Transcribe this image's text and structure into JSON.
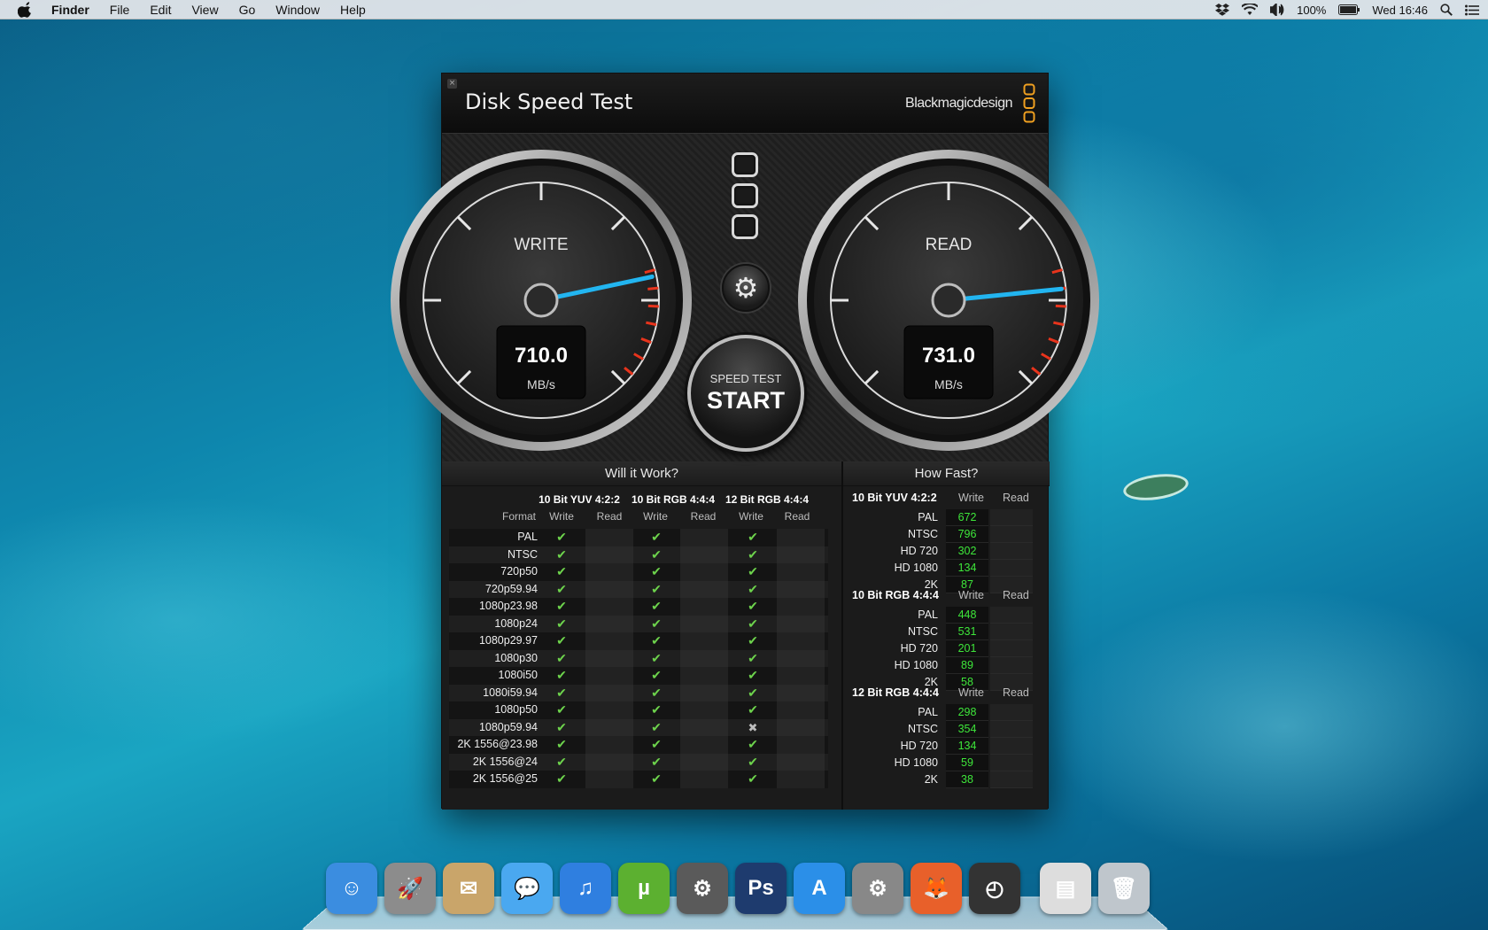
{
  "menubar": {
    "app_name": "Finder",
    "items": [
      "File",
      "Edit",
      "View",
      "Go",
      "Window",
      "Help"
    ],
    "status": {
      "battery": "100%",
      "clock": "Wed 16:46"
    }
  },
  "window": {
    "title": "Disk Speed Test",
    "brand": "Blackmagicdesign",
    "close_glyph": "×",
    "gauges": {
      "write": {
        "label": "WRITE",
        "value": "710.0",
        "unit": "MB/s",
        "needle_value": 710
      },
      "read": {
        "label": "READ",
        "value": "731.0",
        "unit": "MB/s",
        "needle_value": 731
      }
    },
    "gauge_scale_max": 900,
    "start_button": {
      "line1": "SPEED TEST",
      "line2": "START"
    },
    "gear_icon": "⚙",
    "will_it_work": {
      "title": "Will it Work?",
      "format_header": "Format",
      "groups": [
        {
          "name": "10 Bit YUV 4:2:2",
          "write": "Write",
          "read": "Read"
        },
        {
          "name": "10 Bit RGB 4:4:4",
          "write": "Write",
          "read": "Read"
        },
        {
          "name": "12 Bit RGB 4:4:4",
          "write": "Write",
          "read": "Read"
        }
      ],
      "rows": [
        {
          "format": "PAL",
          "w": [
            "✔",
            "✔",
            "✔"
          ]
        },
        {
          "format": "NTSC",
          "w": [
            "✔",
            "✔",
            "✔"
          ]
        },
        {
          "format": "720p50",
          "w": [
            "✔",
            "✔",
            "✔"
          ]
        },
        {
          "format": "720p59.94",
          "w": [
            "✔",
            "✔",
            "✔"
          ]
        },
        {
          "format": "1080p23.98",
          "w": [
            "✔",
            "✔",
            "✔"
          ]
        },
        {
          "format": "1080p24",
          "w": [
            "✔",
            "✔",
            "✔"
          ]
        },
        {
          "format": "1080p29.97",
          "w": [
            "✔",
            "✔",
            "✔"
          ]
        },
        {
          "format": "1080p30",
          "w": [
            "✔",
            "✔",
            "✔"
          ]
        },
        {
          "format": "1080i50",
          "w": [
            "✔",
            "✔",
            "✔"
          ]
        },
        {
          "format": "1080i59.94",
          "w": [
            "✔",
            "✔",
            "✔"
          ]
        },
        {
          "format": "1080p50",
          "w": [
            "✔",
            "✔",
            "✔"
          ]
        },
        {
          "format": "1080p59.94",
          "w": [
            "✔",
            "✔",
            "✖"
          ]
        },
        {
          "format": "2K 1556@23.98",
          "w": [
            "✔",
            "✔",
            "✔"
          ]
        },
        {
          "format": "2K 1556@24",
          "w": [
            "✔",
            "✔",
            "✔"
          ]
        },
        {
          "format": "2K 1556@25",
          "w": [
            "✔",
            "✔",
            "✔"
          ]
        }
      ]
    },
    "how_fast": {
      "title": "How Fast?",
      "groups": [
        {
          "name": "10 Bit YUV 4:2:2",
          "write": "Write",
          "read": "Read",
          "rows": [
            {
              "f": "PAL",
              "v": "672"
            },
            {
              "f": "NTSC",
              "v": "796"
            },
            {
              "f": "HD 720",
              "v": "302"
            },
            {
              "f": "HD 1080",
              "v": "134"
            },
            {
              "f": "2K",
              "v": "87"
            }
          ]
        },
        {
          "name": "10 Bit RGB 4:4:4",
          "write": "Write",
          "read": "Read",
          "rows": [
            {
              "f": "PAL",
              "v": "448"
            },
            {
              "f": "NTSC",
              "v": "531"
            },
            {
              "f": "HD 720",
              "v": "201"
            },
            {
              "f": "HD 1080",
              "v": "89"
            },
            {
              "f": "2K",
              "v": "58"
            }
          ]
        },
        {
          "name": "12 Bit RGB 4:4:4",
          "write": "Write",
          "read": "Read",
          "rows": [
            {
              "f": "PAL",
              "v": "298"
            },
            {
              "f": "NTSC",
              "v": "354"
            },
            {
              "f": "HD 720",
              "v": "134"
            },
            {
              "f": "HD 1080",
              "v": "59"
            },
            {
              "f": "2K",
              "v": "38"
            }
          ]
        }
      ]
    }
  },
  "dock": {
    "items": [
      {
        "name": "finder-icon",
        "glyph": "☺",
        "color": "#3b8de0"
      },
      {
        "name": "launchpad-icon",
        "glyph": "🚀",
        "color": "#8c8c8c"
      },
      {
        "name": "mail-icon",
        "glyph": "✉",
        "color": "#c9a56a"
      },
      {
        "name": "messages-icon",
        "glyph": "💬",
        "color": "#4aa8f0"
      },
      {
        "name": "itunes-icon",
        "glyph": "♫",
        "color": "#2f7fe0"
      },
      {
        "name": "utorrent-icon",
        "glyph": "µ",
        "color": "#5cb030"
      },
      {
        "name": "steam-icon",
        "glyph": "⚙",
        "color": "#5a5a5a"
      },
      {
        "name": "photoshop-icon",
        "glyph": "Ps",
        "color": "#1e3b6e"
      },
      {
        "name": "app-store-icon",
        "glyph": "A",
        "color": "#2b8fe8"
      },
      {
        "name": "system-preferences-icon",
        "glyph": "⚙",
        "color": "#888888"
      },
      {
        "name": "firefox-icon",
        "glyph": "🦊",
        "color": "#e8602a"
      },
      {
        "name": "disk-speed-test-icon",
        "glyph": "◴",
        "color": "#333333"
      },
      {
        "name": "downloads-stack-icon",
        "glyph": "▤",
        "color": "#dddddd"
      },
      {
        "name": "trash-icon",
        "glyph": "🗑",
        "color": "#bfc6cc"
      }
    ]
  }
}
